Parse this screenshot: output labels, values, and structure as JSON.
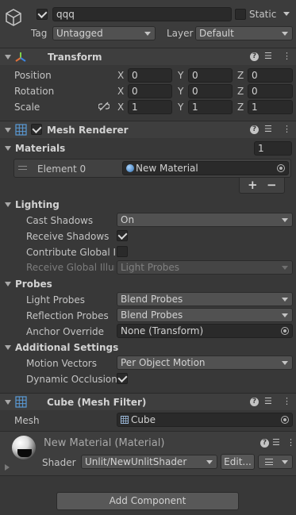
{
  "object": {
    "name": "qqq",
    "static_label": "Static",
    "tag_label": "Tag",
    "tag_value": "Untagged",
    "layer_label": "Layer",
    "layer_value": "Default"
  },
  "transform": {
    "title": "Transform",
    "position_label": "Position",
    "rotation_label": "Rotation",
    "scale_label": "Scale",
    "axis_x": "X",
    "axis_y": "Y",
    "axis_z": "Z",
    "position": [
      "0",
      "0",
      "0"
    ],
    "rotation": [
      "0",
      "0",
      "0"
    ],
    "scale": [
      "1",
      "1",
      "1"
    ]
  },
  "mesh_renderer": {
    "title": "Mesh Renderer",
    "materials_label": "Materials",
    "materials_count": "1",
    "element_label": "Element 0",
    "element_value": "New Material",
    "plus": "+",
    "minus": "−",
    "lighting_label": "Lighting",
    "cast_shadows_label": "Cast Shadows",
    "cast_shadows_value": "On",
    "receive_shadows_label": "Receive Shadows",
    "contribute_gi_label": "Contribute Global Illumination",
    "receive_gi_label": "Receive Global Illumination",
    "receive_gi_value": "Light Probes",
    "probes_label": "Probes",
    "light_probes_label": "Light Probes",
    "light_probes_value": "Blend Probes",
    "reflection_probes_label": "Reflection Probes",
    "reflection_probes_value": "Blend Probes",
    "anchor_override_label": "Anchor Override",
    "anchor_override_value": "None (Transform)",
    "additional_label": "Additional Settings",
    "motion_vectors_label": "Motion Vectors",
    "motion_vectors_value": "Per Object Motion",
    "dynamic_occlusion_label": "Dynamic Occlusion"
  },
  "mesh_filter": {
    "title": "Cube (Mesh Filter)",
    "mesh_label": "Mesh",
    "mesh_value": "Cube"
  },
  "material": {
    "title": "New Material (Material)",
    "shader_label": "Shader",
    "shader_value": "Unlit/NewUnlitShader",
    "edit_label": "Edit..."
  },
  "footer": {
    "add_component_label": "Add Component"
  }
}
